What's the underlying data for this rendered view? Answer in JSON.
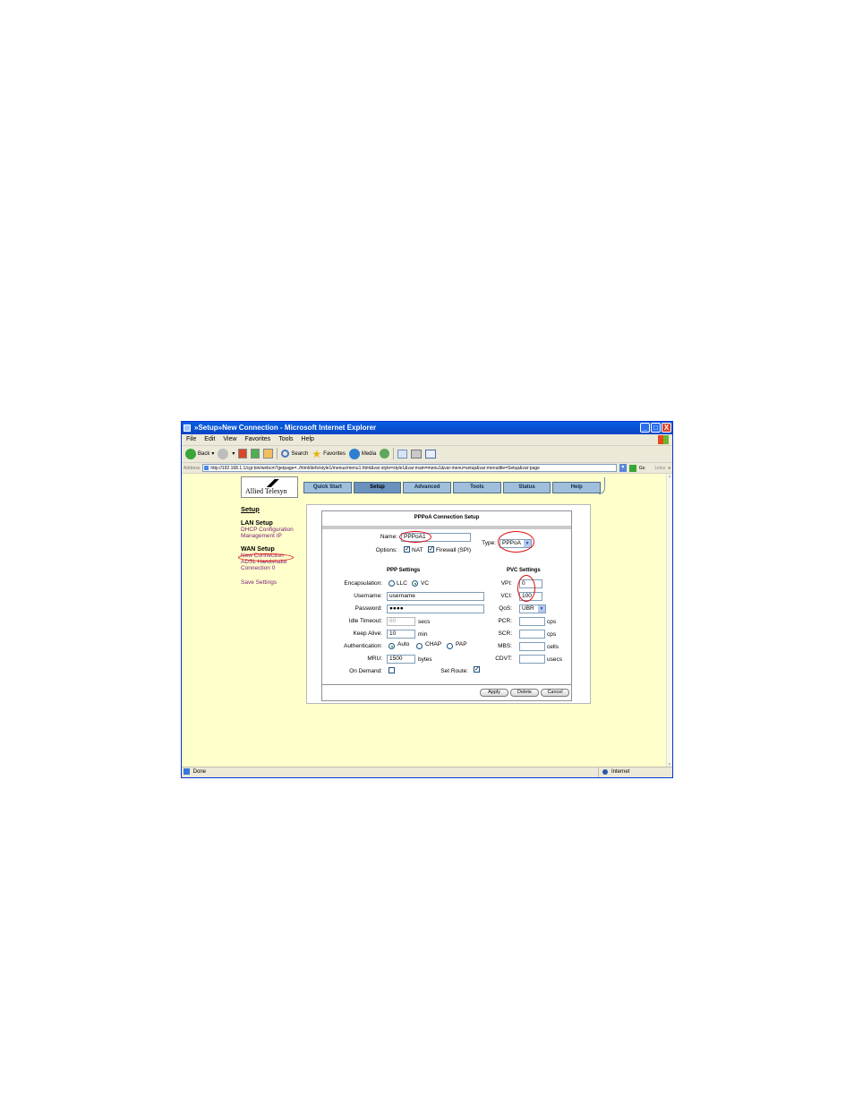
{
  "window": {
    "title": "»Setup»New Connection - Microsoft Internet Explorer",
    "controls": [
      "_",
      "□",
      "X"
    ]
  },
  "menubar": [
    "File",
    "Edit",
    "View",
    "Favorites",
    "Tools",
    "Help"
  ],
  "toolbar": {
    "back": "Back",
    "search": "Search",
    "favorites": "Favorites",
    "media": "Media"
  },
  "addressbar": {
    "label": "Address",
    "url": "http://192.168.1.1/cgi-bin/webcm?getpage=../html/defs/style1/menus/menu1.html&var:style=style1&var:main=menu1&var:menu=setup&var:menutitle=Setup&var:page",
    "go": "Go",
    "links": "Links"
  },
  "logo": {
    "text": "Allied Telesyn"
  },
  "nav": {
    "tabs": [
      "Quick Start",
      "Setup",
      "Advanced",
      "Tools",
      "Status",
      "Help"
    ],
    "active": "Setup"
  },
  "sidebar": {
    "title": "Setup",
    "lan_heading": "LAN Setup",
    "lan_items": [
      "DHCP Configuration",
      "Management IP"
    ],
    "wan_heading": "WAN Setup",
    "wan_items": [
      "New Connection",
      "ADSL Handshake",
      "Connection 0"
    ],
    "save": "Save Settings"
  },
  "form": {
    "title": "PPPoA Connection Setup",
    "name_label": "Name:",
    "name_value": "PPPoA1",
    "type_label": "Type:",
    "type_value": "PPPoA",
    "options_label": "Options:",
    "nat_label": "NAT",
    "firewall_label": "Firewall (SPI)",
    "nat_checked": true,
    "firewall_checked": true,
    "ppp_heading": "PPP Settings",
    "pvc_heading": "PVC Settings",
    "encapsulation_label": "Encapsulation:",
    "encap_llc": "LLC",
    "encap_vc": "VC",
    "encap_selected": "VC",
    "username_label": "Username:",
    "username_value": "username",
    "password_label": "Password:",
    "password_value": "●●●●",
    "idle_label": "Idle Timeout:",
    "idle_value": "60",
    "idle_unit": "secs",
    "keepalive_label": "Keep Alive:",
    "keepalive_value": "10",
    "keepalive_unit": "min",
    "auth_label": "Authentication:",
    "auth_auto": "Auto",
    "auth_chap": "CHAP",
    "auth_pap": "PAP",
    "auth_selected": "Auto",
    "mru_label": "MRU:",
    "mru_value": "1500",
    "mru_unit": "bytes",
    "ondemand_label": "On Demand:",
    "ondemand_checked": false,
    "setroute_label": "Set Route:",
    "setroute_checked": true,
    "vpi_label": "VPI:",
    "vpi_value": "0",
    "vci_label": "VCI:",
    "vci_value": "100",
    "qos_label": "QoS:",
    "qos_value": "UBR",
    "pcr_label": "PCR:",
    "pcr_unit": "cps",
    "scr_label": "SCR:",
    "scr_unit": "cps",
    "mbs_label": "MBS:",
    "mbs_unit": "cells",
    "cdvt_label": "CDVT:",
    "cdvt_unit": "usecs",
    "apply": "Apply",
    "delete": "Delete",
    "cancel": "Cancel"
  },
  "status": {
    "left": "Done",
    "zone": "Internet"
  },
  "accent": {
    "titlebar": "#0a5fe0",
    "content_bg": "#ffffcc",
    "annotation": "#e01010"
  }
}
